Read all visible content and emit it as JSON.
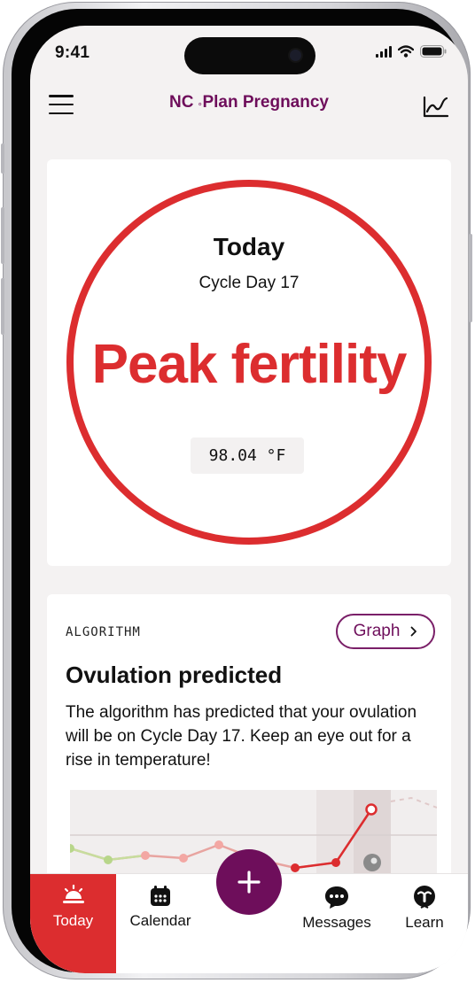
{
  "status_bar": {
    "time": "9:41"
  },
  "header": {
    "brand_prefix": "NC",
    "brand_degree": "°",
    "brand_name": "Plan Pregnancy"
  },
  "today_card": {
    "title": "Today",
    "cycle_day": "Cycle Day 17",
    "fertility_status": "Peak fertility",
    "temperature": "98.04 °F"
  },
  "algorithm_card": {
    "label": "ALGORITHM",
    "graph_button": "Graph",
    "title": "Ovulation predicted",
    "body": "The algorithm has predicted that your ovulation will be on Cycle Day 17. Keep an eye out for a rise in temperature!"
  },
  "tabs": [
    {
      "label": "Today",
      "icon": "sunrise-icon",
      "active": true
    },
    {
      "label": "Calendar",
      "icon": "calendar-icon",
      "active": false
    },
    {
      "label": "Messages",
      "icon": "chat-bubble-icon",
      "active": false
    },
    {
      "label": "Learn",
      "icon": "learn-icon",
      "active": false
    }
  ],
  "fab": {
    "icon": "plus-icon"
  },
  "colors": {
    "accent_red": "#dc2d2f",
    "brand_purple": "#6e0e5b",
    "green_point": "#b8d68a",
    "pink_point": "#f3a7a3",
    "gray_point": "#8a8a8a"
  }
}
